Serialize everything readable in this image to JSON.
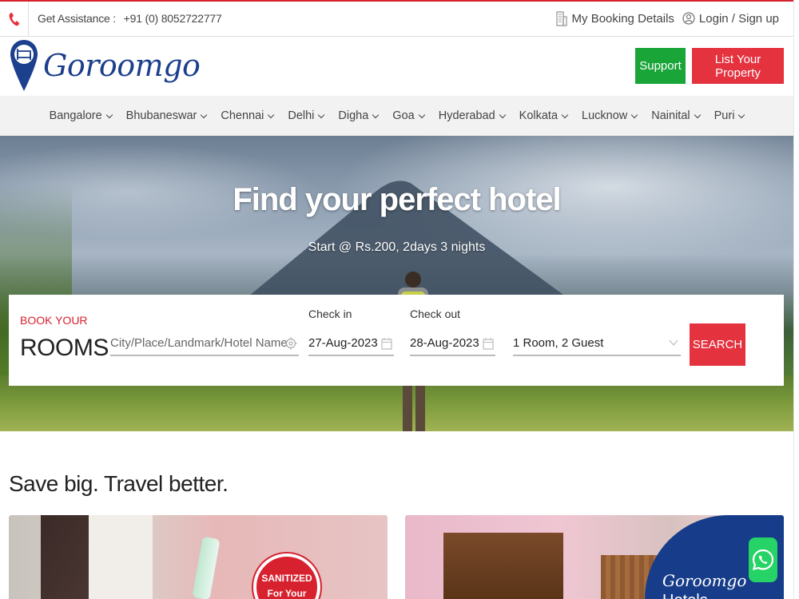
{
  "topbar": {
    "assistance_label": "Get Assistance :",
    "phone": "+91 (0) 8052722777",
    "booking_details": "My Booking Details",
    "login": "Login / Sign up"
  },
  "header": {
    "brand": "Goroomgo",
    "support_label": "Support",
    "list_property_label": "List Your Property"
  },
  "cities": [
    {
      "label": "Bangalore"
    },
    {
      "label": "Bhubaneswar"
    },
    {
      "label": "Chennai"
    },
    {
      "label": "Delhi"
    },
    {
      "label": "Digha"
    },
    {
      "label": "Goa"
    },
    {
      "label": "Hyderabad"
    },
    {
      "label": "Kolkata"
    },
    {
      "label": "Lucknow"
    },
    {
      "label": "Nainital"
    },
    {
      "label": "Puri"
    }
  ],
  "hero": {
    "title": "Find your perfect hotel",
    "subtitle": "Start @ Rs.200, 2days 3 nights"
  },
  "search": {
    "book_your": "BOOK YOUR",
    "rooms": "ROOMS",
    "location_placeholder": "City/Place/Landmark/Hotel Name",
    "checkin_label": "Check in",
    "checkin_value": "27-Aug-2023",
    "checkout_label": "Check out",
    "checkout_value": "28-Aug-2023",
    "guests_value": "1 Room, 2 Guest",
    "search_label": "SEARCH"
  },
  "deals": {
    "title": "Save big. Travel better.",
    "card1_stamp_line1": "SANITIZED",
    "card1_stamp_line2": "For Your",
    "card2_brand": "Goroomgo",
    "card2_hotels": "Hotels"
  },
  "colors": {
    "accent_red": "#e5323f",
    "support_green": "#19a538",
    "brand_blue": "#1c3f8e"
  }
}
